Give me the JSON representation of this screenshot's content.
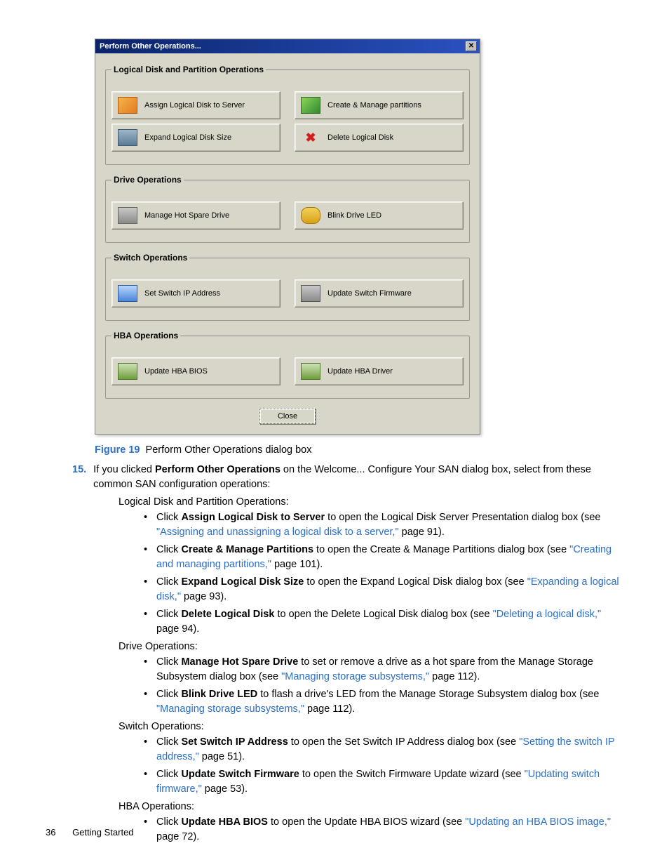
{
  "dialog": {
    "title": "Perform Other Operations...",
    "groups": [
      {
        "legend": "Logical Disk and Partition Operations",
        "rows": [
          [
            "Assign Logical Disk to Server",
            "Create & Manage partitions"
          ],
          [
            "Expand Logical Disk Size",
            "Delete Logical Disk"
          ]
        ]
      },
      {
        "legend": "Drive Operations",
        "rows": [
          [
            "Manage Hot Spare Drive",
            "Blink Drive LED"
          ]
        ]
      },
      {
        "legend": "Switch Operations",
        "rows": [
          [
            "Set Switch IP Address",
            "Update Switch Firmware"
          ]
        ]
      },
      {
        "legend": "HBA Operations",
        "rows": [
          [
            "Update HBA BIOS",
            "Update HBA Driver"
          ]
        ]
      }
    ],
    "close": "Close"
  },
  "caption": {
    "fig": "Figure 19",
    "text": "Perform Other Operations dialog box"
  },
  "step": {
    "num": "15.",
    "text1": "If you clicked ",
    "bold": "Perform Other Operations",
    "text2": " on the Welcome... Configure Your SAN dialog box, select from these common SAN configuration operations:"
  },
  "sections": [
    {
      "heading": "Logical Disk and Partition Operations:",
      "items": [
        {
          "pre": "Click ",
          "bold": "Assign Logical Disk to Server",
          "mid": " to open the Logical Disk Server Presentation dialog box (see ",
          "link": "\"Assigning and unassigning a logical disk to a server,\"",
          "post": " page 91)."
        },
        {
          "pre": "Click ",
          "bold": "Create & Manage Partitions",
          "mid": " to open the Create & Manage Partitions dialog box (see ",
          "link": "\"Creating and managing partitions,\"",
          "post": " page 101)."
        },
        {
          "pre": "Click ",
          "bold": "Expand Logical Disk Size",
          "mid": " to open the Expand Logical Disk dialog box (see ",
          "link": "\"Expanding a logical disk,\"",
          "post": " page 93)."
        },
        {
          "pre": "Click ",
          "bold": "Delete Logical Disk",
          "mid": " to open the Delete Logical Disk dialog box (see ",
          "link": "\"Deleting a logical disk,\"",
          "post": " page 94)."
        }
      ]
    },
    {
      "heading": "Drive Operations:",
      "items": [
        {
          "pre": "Click ",
          "bold": "Manage Hot Spare Drive",
          "mid": " to set or remove a drive as a hot spare from the Manage Storage Subsystem dialog box (see ",
          "link": "\"Managing storage subsystems,\"",
          "post": " page 112)."
        },
        {
          "pre": "Click ",
          "bold": "Blink Drive LED",
          "mid": " to flash a drive's LED from the Manage Storage Subsystem dialog box (see ",
          "link": "\"Managing storage subsystems,\"",
          "post": " page 112)."
        }
      ]
    },
    {
      "heading": "Switch Operations:",
      "items": [
        {
          "pre": "Click ",
          "bold": "Set Switch IP Address",
          "mid": " to open the Set Switch IP Address dialog box (see ",
          "link": "\"Setting the switch IP address,\"",
          "post": " page 51)."
        },
        {
          "pre": "Click ",
          "bold": "Update Switch Firmware",
          "mid": " to open the Switch Firmware Update wizard (see ",
          "link": "\"Updating switch firmware,\"",
          "post": " page 53)."
        }
      ]
    },
    {
      "heading": "HBA Operations:",
      "items": [
        {
          "pre": "Click ",
          "bold": "Update HBA BIOS",
          "mid": " to open the Update HBA BIOS wizard (see ",
          "link": "\"Updating an HBA BIOS image,\"",
          "post": " page 72)."
        }
      ]
    }
  ],
  "footer": {
    "page": "36",
    "section": "Getting Started"
  }
}
